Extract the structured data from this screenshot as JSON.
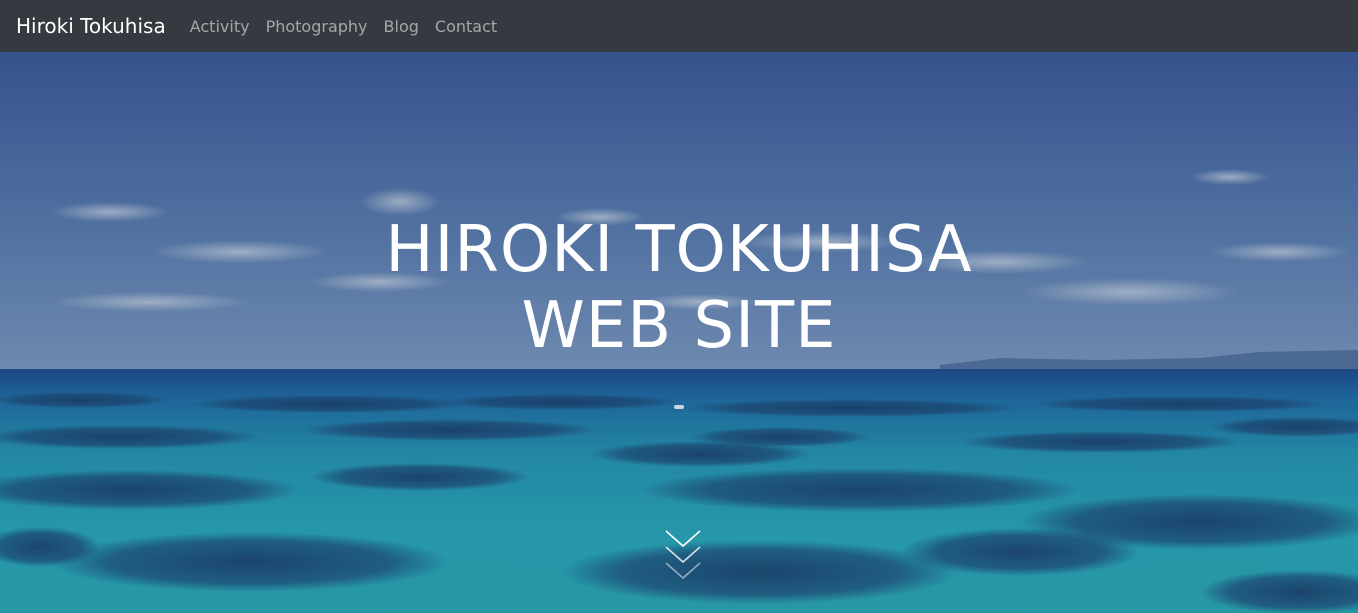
{
  "navbar": {
    "brand": "Hiroki Tokuhisa",
    "links": [
      "Activity",
      "Photography",
      "Blog",
      "Contact"
    ]
  },
  "hero": {
    "title_line1": "HIROKI TOKUHISA",
    "title_line2": "WEB SITE",
    "scroll_icon": "chevron-triple-down-icon"
  },
  "colors": {
    "navbar_bg": "#343a40",
    "sky_top": "#3d5f9c",
    "sea": "#25a6b8"
  }
}
